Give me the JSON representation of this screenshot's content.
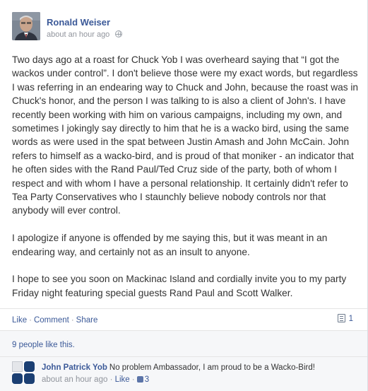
{
  "post": {
    "author": "Ronald Weiser",
    "timestamp": "about an hour ago",
    "privacy_icon": "globe-icon",
    "paragraphs": [
      "Two days ago at a roast for Chuck Yob I was overheard saying that “I got the wackos under control”. I don't believe those were my exact words, but regardless I was referring in an endearing way to Chuck and John, because the roast was in Chuck's honor, and the person I was talking to is also a client of John's. I have recently been working with him on various campaigns, including my own, and sometimes I jokingly say directly to him that he is a wacko bird, using the same words as were used in the spat between Justin Amash and John McCain. John refers to himself as a wacko-bird, and is proud of that moniker - an indicator that he often sides with the Rand Paul/Ted Cruz side of the party, both of whom I respect and with whom I have a personal relationship. It certainly didn't refer to Tea Party Conservatives who I staunchly believe nobody controls nor that anybody will ever control.",
      "I apologize if anyone is offended by me saying this, but it was meant in an endearing way, and certainly not as an insult to anyone.",
      "I hope to see you soon on Mackinac Island and cordially invite you to my party Friday night featuring special guests Rand Paul and Scott Walker."
    ]
  },
  "actions": {
    "like": "Like",
    "comment": "Comment",
    "share": "Share",
    "separator": "·",
    "comment_count": "1"
  },
  "likes": {
    "text": "9 people like this."
  },
  "comment": {
    "author": "John Patrick Yob",
    "text": "No problem Ambassador, I am proud to be a Wacko-Bird!",
    "timestamp": "about an hour ago",
    "separator": "·",
    "like": "Like",
    "like_count": "3"
  },
  "colors": {
    "link": "#3b5998",
    "text": "#333333",
    "muted": "#90949c",
    "panel_bg": "#f6f7f9"
  }
}
